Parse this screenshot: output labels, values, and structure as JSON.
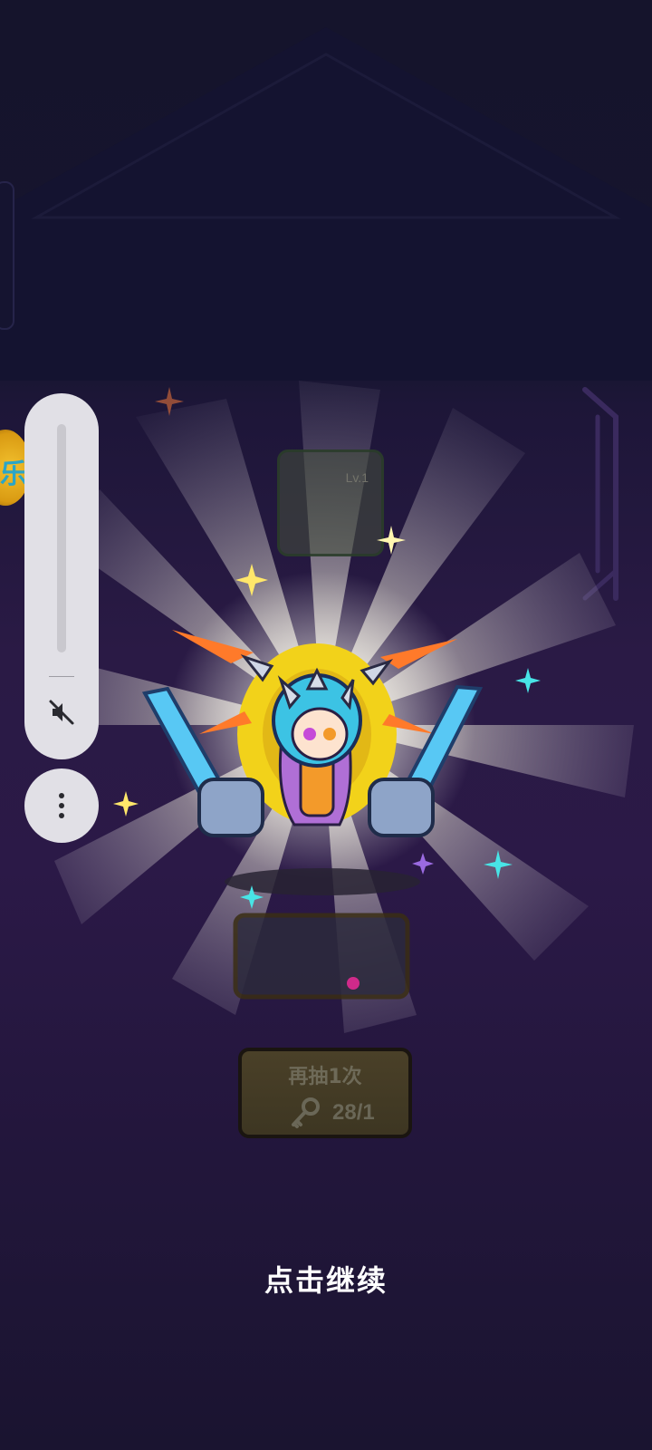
{
  "badge": {
    "glyph": "乐"
  },
  "skill_card": {
    "level": "Lv.1"
  },
  "draw_again": {
    "label": "再抽1次",
    "cost": "28/1",
    "icon": "key-icon"
  },
  "continue_prompt": "点击继续",
  "volume_overlay": {
    "mute_icon": "volume-muted-icon",
    "more_icon": "more-vertical-icon",
    "level": 0
  },
  "colors": {
    "background": "#16152e",
    "button_fill": "#4a4028",
    "overlay": "#e1e0e6",
    "text": "#ffffff"
  }
}
